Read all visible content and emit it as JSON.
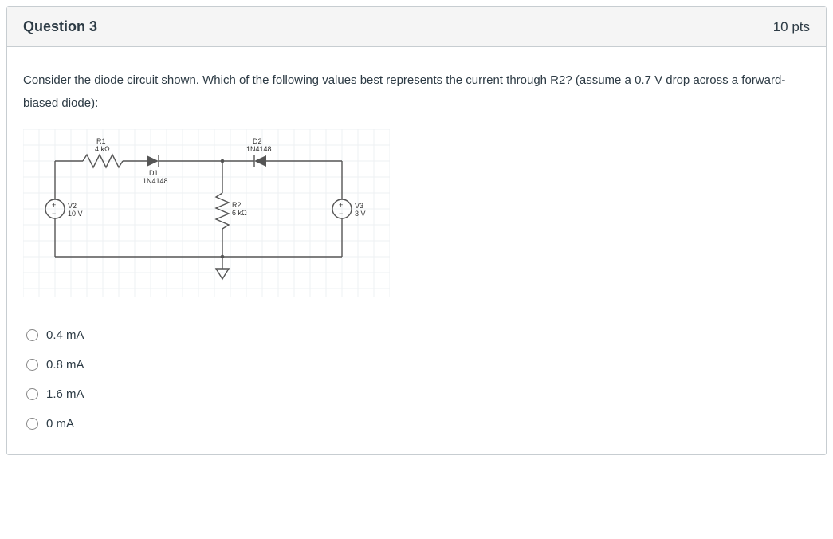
{
  "header": {
    "title": "Question 3",
    "points": "10 pts"
  },
  "prompt": "Consider the diode circuit shown. Which of the following values best represents the current through R2? (assume a 0.7 V drop across a forward-biased diode):",
  "circuit": {
    "R1": {
      "name": "R1",
      "value": "4 kΩ"
    },
    "R2": {
      "name": "R2",
      "value": "6 kΩ"
    },
    "D1": {
      "name": "D1",
      "part": "1N4148"
    },
    "D2": {
      "name": "D2",
      "part": "1N4148"
    },
    "V2": {
      "name": "V2",
      "value": "10 V"
    },
    "V3": {
      "name": "V3",
      "value": "3 V"
    }
  },
  "answers": {
    "a": "0.4 mA",
    "b": "0.8 mA",
    "c": "1.6 mA",
    "d": "0 mA"
  }
}
